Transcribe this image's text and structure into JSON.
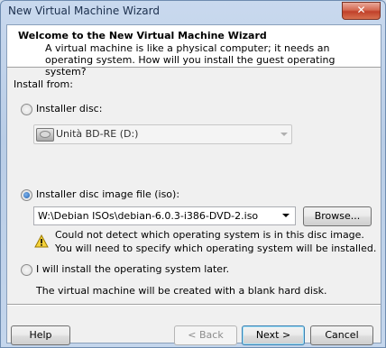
{
  "window": {
    "title": "New Virtual Machine Wizard",
    "close_glyph": "✕"
  },
  "header": {
    "title": "Welcome to the New Virtual Machine Wizard",
    "description": "A virtual machine is like a physical computer; it needs an operating system. How will you install the guest operating system?"
  },
  "install_from": {
    "label": "Install from:",
    "options": {
      "disc": {
        "label": "Installer disc:",
        "selected": false
      },
      "iso": {
        "label": "Installer disc image file (iso):",
        "selected": true
      },
      "later": {
        "label": "I will install the operating system later.",
        "selected": false
      }
    },
    "disc_combo": {
      "value": "Unità BD-RE (D:)",
      "enabled": false,
      "icon": "optical-drive-icon"
    },
    "iso_path": {
      "value": "W:\\Debian ISOs\\debian-6.0.3-i386-DVD-2.iso"
    },
    "browse_label": "Browse...",
    "warning": {
      "icon": "warning-icon",
      "line1": "Could not detect which operating system is in this disc image.",
      "line2": "You will need to specify which operating system will be installed."
    },
    "later_note": "The virtual machine will be created with a blank hard disk."
  },
  "footer": {
    "help_label": "Help",
    "back_label": "< Back",
    "next_label": "Next >",
    "cancel_label": "Cancel"
  },
  "colors": {
    "window_frame": "#b9cde6",
    "close_button": "#c0402a",
    "default_button_border": "#3c7fb1"
  }
}
